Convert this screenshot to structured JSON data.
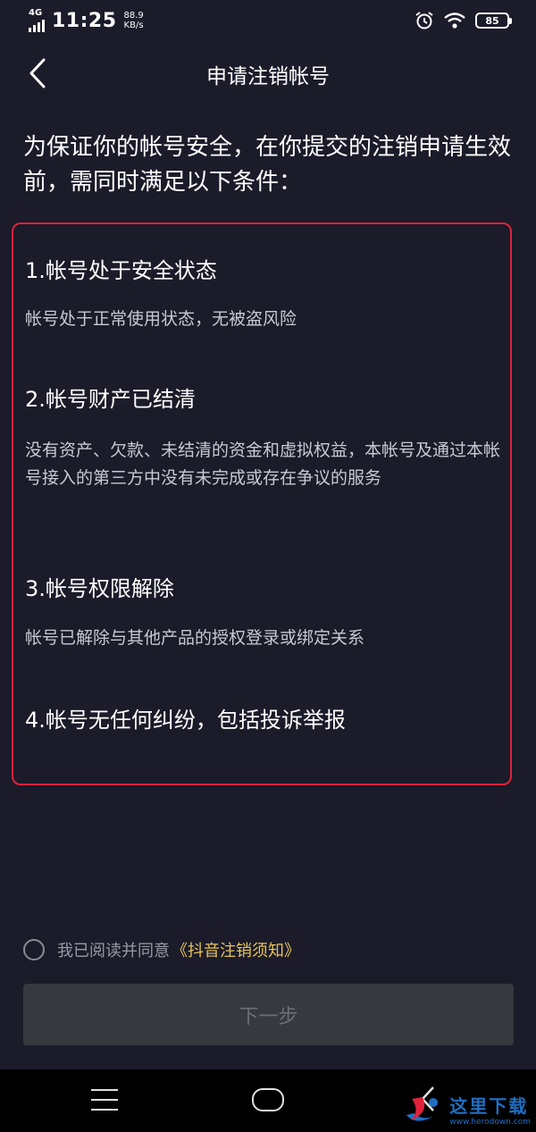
{
  "status_bar": {
    "network": "4G",
    "time": "11:25",
    "speed_value": "88.9",
    "speed_unit": "KB/s",
    "battery": "85",
    "icons": [
      "alarm-icon",
      "wifi-icon",
      "battery-icon"
    ]
  },
  "header": {
    "back_icon": "chevron-left-icon",
    "title": "申请注销帐号"
  },
  "intro": "为保证你的帐号安全，在你提交的注销申请生效前，需同时满足以下条件：",
  "conditions": [
    {
      "title": "1.帐号处于安全状态",
      "desc": "帐号处于正常使用状态，无被盗风险"
    },
    {
      "title": "2.帐号财产已结清",
      "desc": "没有资产、欠款、未结清的资金和虚拟权益，本帐号及通过本帐号接入的第三方中没有未完成或存在争议的服务"
    },
    {
      "title": "3.帐号权限解除",
      "desc": "帐号已解除与其他产品的授权登录或绑定关系"
    },
    {
      "title": "4.帐号无任何纠纷，包括投诉举报",
      "desc": ""
    }
  ],
  "agreement": {
    "checked": false,
    "text": "我已阅读并同意",
    "link": "《抖音注销须知》"
  },
  "next_button": {
    "label": "下一步",
    "enabled": false
  },
  "nav_bar": {
    "icons": [
      "menu-icon",
      "home-icon",
      "back-icon"
    ]
  },
  "watermark": {
    "title": "这里下载",
    "url": "www.herodown.com"
  },
  "colors": {
    "background": "#1b1b2a",
    "highlight_border": "#e0223b",
    "link": "#e7c35a",
    "button_disabled": "#38383f"
  }
}
